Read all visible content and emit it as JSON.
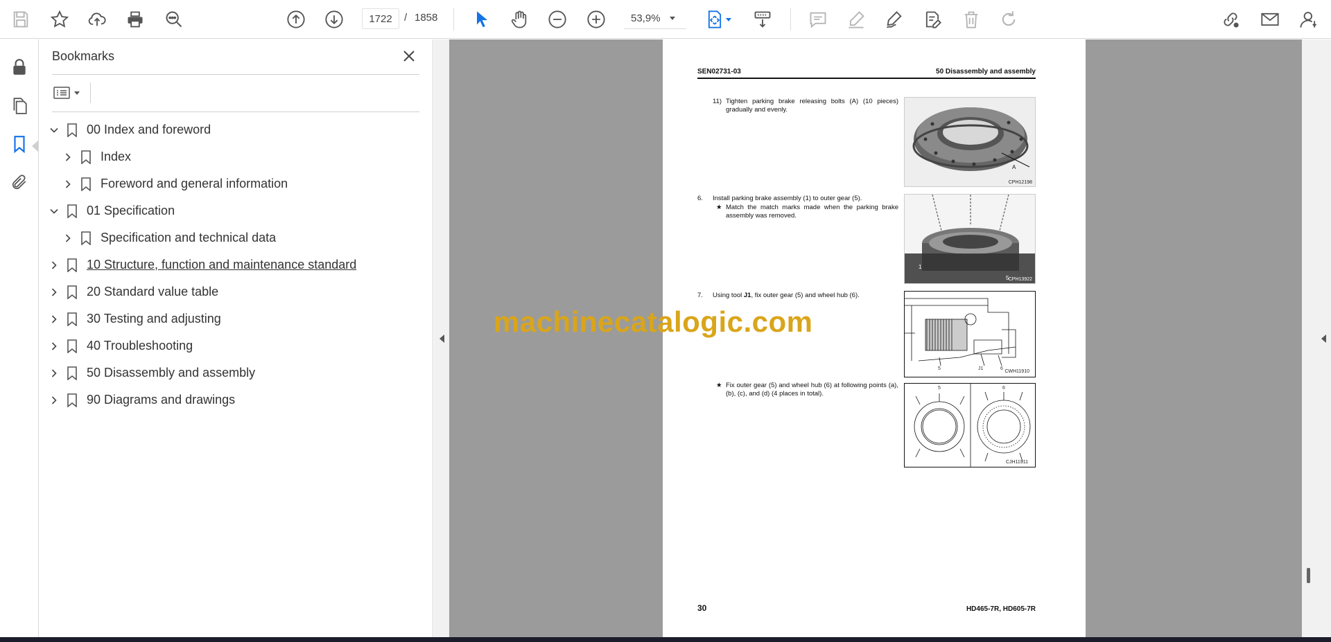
{
  "toolbar": {
    "page_current": "1722",
    "page_separator": "/",
    "page_total": "1858",
    "zoom": "53,9%",
    "accent_color": "#1473e6",
    "icons": [
      "save-icon",
      "star-icon",
      "cloud-upload-icon",
      "print-icon",
      "zoom-search-icon",
      "page-up-icon",
      "page-down-icon",
      "zoom-out-icon",
      "zoom-in-icon",
      "select-arrow-icon",
      "hand-icon",
      "page-fit-icon",
      "scroll-mode-icon",
      "comment-icon",
      "highlight-pen-icon",
      "sign-icon",
      "edit-doc-icon",
      "delete-icon",
      "redo-icon",
      "share-link-icon",
      "mail-icon",
      "account-icon"
    ]
  },
  "rail": {
    "icons": [
      "lock-icon",
      "pages-icon",
      "bookmark-icon",
      "attachment-icon"
    ]
  },
  "bookmarks": {
    "title": "Bookmarks",
    "items": [
      {
        "label": "00 Index and foreword",
        "level": 0,
        "expanded": true
      },
      {
        "label": "Index",
        "level": 1,
        "expanded": false
      },
      {
        "label": "Foreword and general information",
        "level": 1,
        "expanded": false
      },
      {
        "label": "01 Specification",
        "level": 0,
        "expanded": true
      },
      {
        "label": "Specification and technical data",
        "level": 1,
        "expanded": false
      },
      {
        "label": "10 Structure, function and maintenance standard",
        "level": 0,
        "expanded": false,
        "hovered": true
      },
      {
        "label": "20 Standard value table",
        "level": 0,
        "expanded": false
      },
      {
        "label": "30 Testing and adjusting",
        "level": 0,
        "expanded": false
      },
      {
        "label": "40 Troubleshooting",
        "level": 0,
        "expanded": false
      },
      {
        "label": "50 Disassembly and assembly",
        "level": 0,
        "expanded": false
      },
      {
        "label": "90 Diagrams and drawings",
        "level": 0,
        "expanded": false
      }
    ]
  },
  "pdf": {
    "header_left": "SEN02731-03",
    "header_right": "50 Disassembly and assembly",
    "step11_num": "11)",
    "step11_text": "Tighten parking brake releasing bolts (A) (10 pieces) gradually and evenly.",
    "fig1_label": "CPH12198",
    "fig1_callout": "A",
    "step6_num": "6.",
    "step6_text": "Install parking brake assembly (1) to outer gear (5).",
    "step6_star": "★",
    "step6_note": "Match the match marks made when the parking brake assembly was removed.",
    "fig2_label": "CPH13922",
    "fig2_callout1": "1",
    "fig2_callout5": "5",
    "step7_num": "7.",
    "step7_pre": "Using tool ",
    "step7_tool": "J1",
    "step7_post": ", fix outer gear (5) and wheel hub (6).",
    "fig3_label": "CWH11910",
    "fig3_c5": "5",
    "fig3_cj1": "J1",
    "fig3_c6": "6",
    "note_star": "★",
    "note_text": "Fix outer gear (5) and wheel hub (6) at following points (a), (b), (c), and (d) (4 places in total).",
    "fig4_label": "CJH11911",
    "fig4_c5": "5",
    "fig4_c6": "6",
    "footer_page": "30",
    "footer_model": "HD465-7R, HD605-7R"
  },
  "watermark": "machinecatalogic.com",
  "watermark_color": "#d9a51a"
}
